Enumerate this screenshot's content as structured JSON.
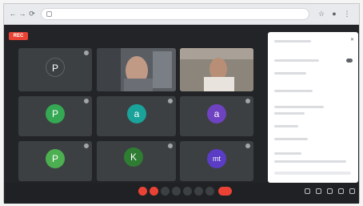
{
  "browser": {
    "url": "",
    "colors": {
      "chrome_bg": "#e9eaee",
      "meet_bg": "#232427",
      "tile_bg": "#3c4043",
      "alert_red": "#ea4335"
    }
  },
  "meet": {
    "recording_label": "REC",
    "tiles": [
      {
        "initial": "P",
        "color": "#3c4043",
        "name": ""
      },
      {
        "video": true,
        "name": ""
      },
      {
        "video": true,
        "name": ""
      },
      {
        "initial": "P",
        "color": "#34a853",
        "name": ""
      },
      {
        "initial": "a",
        "color": "#1aa39a",
        "name": ""
      },
      {
        "initial": "a",
        "color": "#6f42c1",
        "name": ""
      },
      {
        "initial": "P",
        "color": "#4caf50",
        "name": ""
      },
      {
        "initial": "K",
        "color": "#2e7d32",
        "name": ""
      },
      {
        "initial": "mt",
        "color": "#5b3cc4",
        "name": ""
      }
    ],
    "meeting_info": ""
  }
}
